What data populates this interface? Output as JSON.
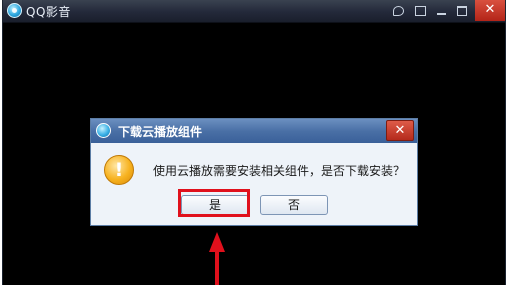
{
  "window": {
    "title": "QQ影音",
    "controls": {
      "close": "✕"
    }
  },
  "dialog": {
    "title": "下载云播放组件",
    "close": "✕",
    "warning_glyph": "!",
    "message": "使用云播放需要安装相关组件，是否下载安装？",
    "yes_label": "是",
    "no_label": "否"
  },
  "annotation": {
    "highlight_color": "#e0101c"
  }
}
